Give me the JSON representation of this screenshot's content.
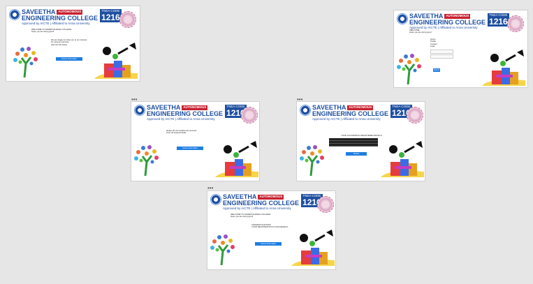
{
  "college": {
    "name_line1": "SAVEETHA",
    "name_line2": "ENGINEERING COLLEGE",
    "autonomous": "AUTONOMOUS",
    "approval": "Approved by AICTE | Affiliated to Anna University",
    "tnea_label": "TNEA CODE",
    "tnea_code": "1216"
  },
  "frames": [
    {
      "dots": "",
      "lines": [
        "WELCOME TO SAVEETHA ENGG COLLEGE",
        "Hope you are doing good!"
      ],
      "lines2": [
        "We are happy to invite you to our campus",
        "for campus interview",
        "click the link below"
      ],
      "button": "Access Information"
    },
    {
      "dots": "",
      "lines": [
        "WELCOME",
        "Hope you are doing good"
      ],
      "links": [
        "Home",
        "Profile",
        "Contact",
        "Login"
      ],
      "button": "Submit"
    },
    {
      "dots": "•••",
      "lines": [
        "please fill your details and proceed",
        "enter all required fields"
      ],
      "button": "Access Information"
    },
    {
      "dots": "•••",
      "lines": [
        "YOUR SUCCESSFUL REGISTERED DETAILS"
      ],
      "button": "Submit"
    },
    {
      "dots": "•••",
      "lines": [
        "WELCOME TO SAVEETHA ENGG COLLEGE",
        "Hope you are doing good!"
      ],
      "lines2": [
        "CONGRATULATIONS",
        "YOUR REGISTRATION IS SUCCESSFUL"
      ],
      "button": "Access Information"
    }
  ]
}
